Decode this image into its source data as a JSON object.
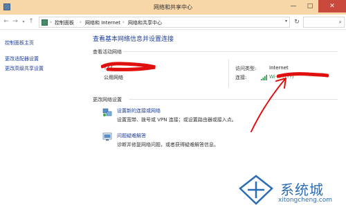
{
  "window": {
    "title": "网络和共享中心",
    "buttons": {
      "minimize": "—",
      "maximize": "□",
      "close": "✕"
    }
  },
  "address": {
    "nav": {
      "back": "←",
      "forward": "→",
      "up": "↑"
    },
    "breadcrumbs": [
      "控制面板",
      "网络和 Internet",
      "网络和共享中心"
    ],
    "separator": "›",
    "refresh": "↻",
    "search_icon": "🔍"
  },
  "sidebar": {
    "items": [
      {
        "label": "控制面板主页"
      },
      {
        "label": "更改适配器设置"
      },
      {
        "label": "更改高级共享设置"
      }
    ]
  },
  "main": {
    "title": "查看基本网络信息并设置连接",
    "active_networks_label": "查看活动网络",
    "network": {
      "name": "???",
      "type": "公用网络",
      "access_type_label": "访问类型:",
      "access_type_value": "Internet",
      "connection_label": "连接:",
      "connection_value": "Wi-Fi (???)"
    },
    "change_settings_label": "更改网络设置",
    "tasks": [
      {
        "icon": "network-setup-icon",
        "link": "设置新的连接或网络",
        "desc": "设置宽带、拨号或 VPN 连接；或设置路由器或接入点。"
      },
      {
        "icon": "troubleshoot-icon",
        "link": "问题疑难解答",
        "desc": "诊断并修复网络问题，或者获得疑难解答信息。"
      }
    ]
  },
  "watermark": {
    "name": "系统城",
    "url": "xitongcheng.com"
  },
  "colors": {
    "titlebar": "#f7d6a7",
    "link": "#1e3d9b",
    "annotation_red": "#e01010",
    "close_button": "#c94a3c",
    "watermark_blue": "#2a6cb5"
  }
}
